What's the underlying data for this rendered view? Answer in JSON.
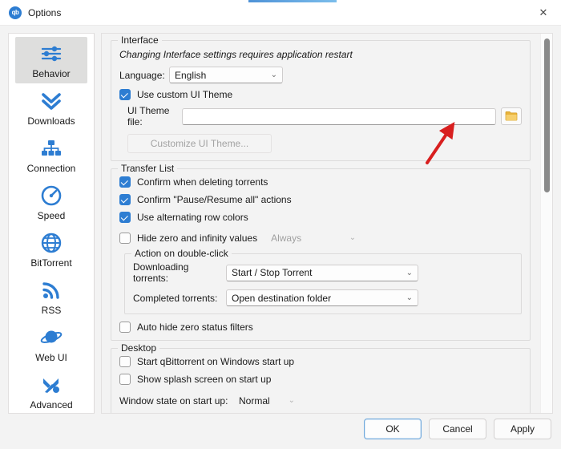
{
  "window": {
    "title": "Options",
    "logo_text": "qb",
    "close_icon": "✕",
    "accent_color": "#2d7dd2"
  },
  "sidebar": {
    "items": [
      {
        "label": "Behavior",
        "icon": "sliders-icon",
        "selected": true
      },
      {
        "label": "Downloads",
        "icon": "double-chevron-down-icon",
        "selected": false
      },
      {
        "label": "Connection",
        "icon": "network-icon",
        "selected": false
      },
      {
        "label": "Speed",
        "icon": "speedometer-icon",
        "selected": false
      },
      {
        "label": "BitTorrent",
        "icon": "globe-icon",
        "selected": false
      },
      {
        "label": "RSS",
        "icon": "rss-icon",
        "selected": false
      },
      {
        "label": "Web UI",
        "icon": "planet-icon",
        "selected": false
      },
      {
        "label": "Advanced",
        "icon": "tools-icon",
        "selected": false
      }
    ]
  },
  "interface": {
    "legend": "Interface",
    "restart_note": "Changing Interface settings requires application restart",
    "language_label": "Language:",
    "language_value": "English",
    "use_custom_theme_label": "Use custom UI Theme",
    "use_custom_theme_checked": true,
    "theme_file_label": "UI Theme file:",
    "theme_file_value": "",
    "theme_file_placeholder": "",
    "browse_icon": "folder-icon",
    "customize_button_label": "Customize UI Theme...",
    "customize_button_disabled": true
  },
  "transfer_list": {
    "legend": "Transfer List",
    "checkboxes": [
      {
        "label": "Confirm when deleting torrents",
        "checked": true
      },
      {
        "label": "Confirm \"Pause/Resume all\" actions",
        "checked": true
      },
      {
        "label": "Use alternating row colors",
        "checked": true
      }
    ],
    "hide_zero_label": "Hide zero and infinity values",
    "hide_zero_checked": false,
    "hide_zero_value": "Always",
    "hide_zero_disabled": true,
    "double_click": {
      "legend": "Action on double-click",
      "downloading_label": "Downloading torrents:",
      "downloading_value": "Start / Stop Torrent",
      "completed_label": "Completed torrents:",
      "completed_value": "Open destination folder"
    },
    "auto_hide_label": "Auto hide zero status filters",
    "auto_hide_checked": false
  },
  "desktop": {
    "legend": "Desktop",
    "checkboxes": [
      {
        "label": "Start qBittorrent on Windows start up",
        "checked": false
      },
      {
        "label": "Show splash screen on start up",
        "checked": false
      }
    ],
    "window_state_label": "Window state on start up:",
    "window_state_value": "Normal"
  },
  "footer": {
    "ok_label": "OK",
    "cancel_label": "Cancel",
    "apply_label": "Apply"
  },
  "annotation": {
    "arrow_color": "#d81f1f",
    "points_to": "folder-browse-button"
  }
}
